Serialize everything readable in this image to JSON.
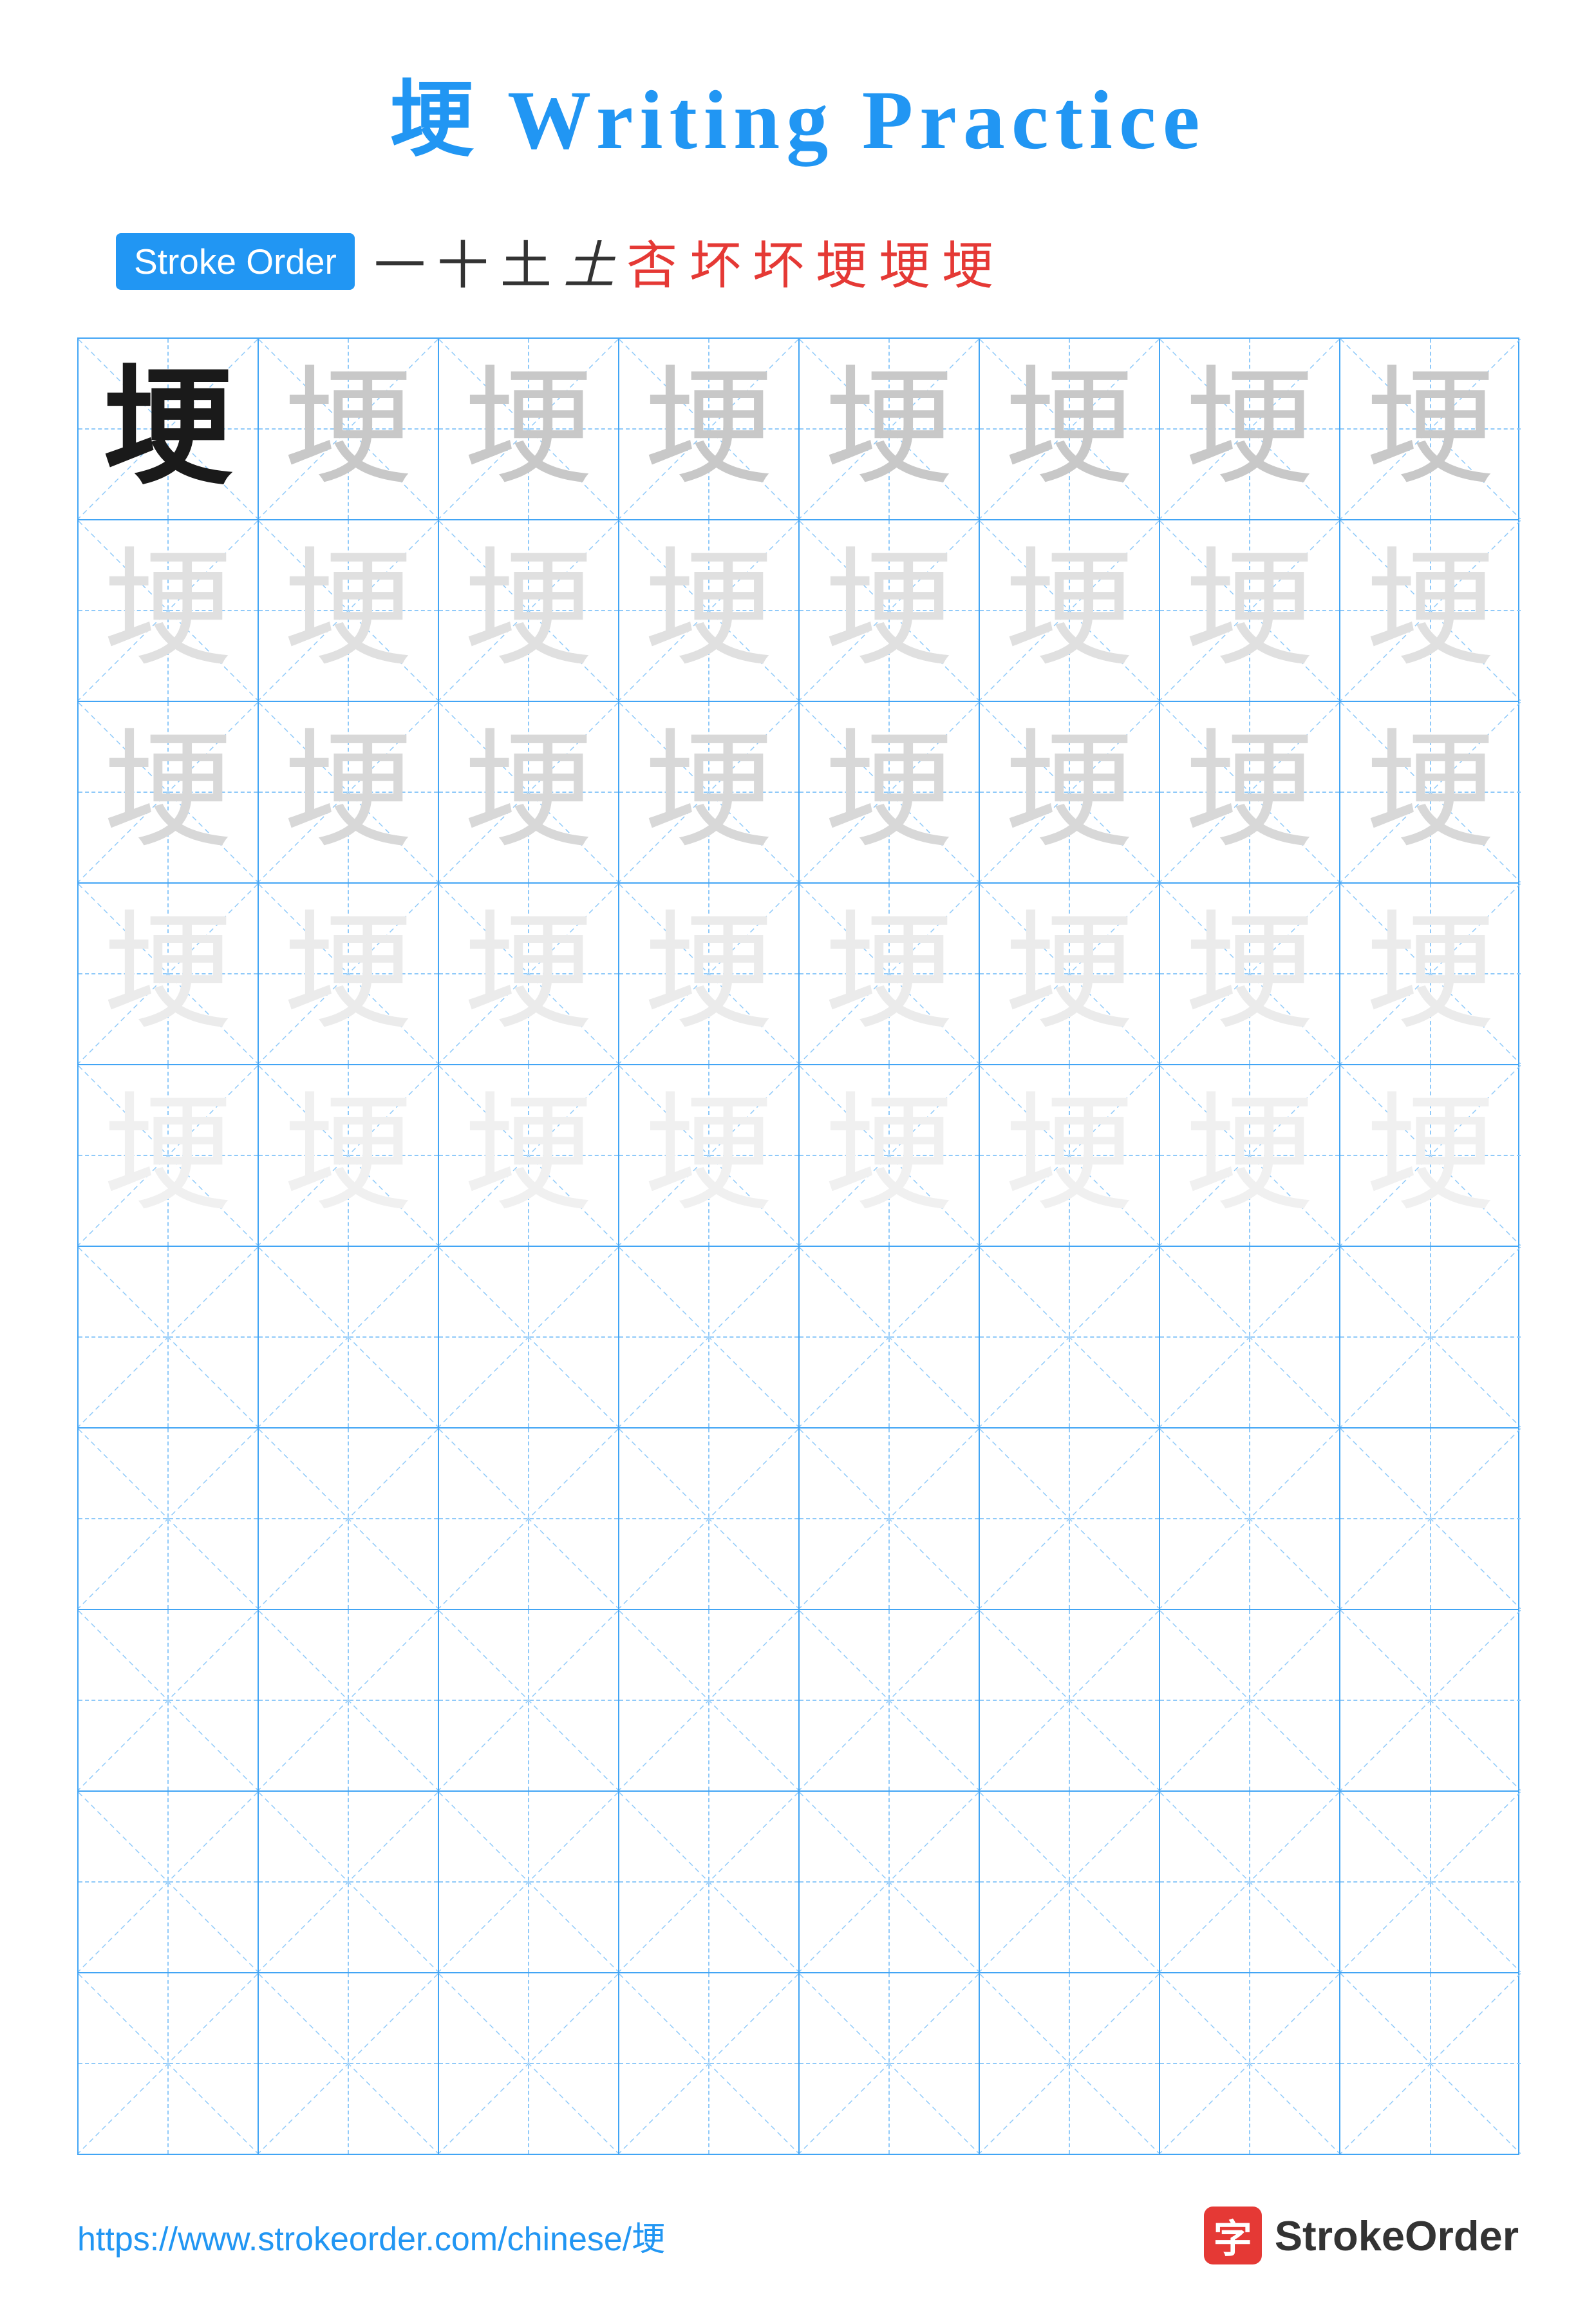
{
  "title": {
    "char": "埂",
    "label": "Writing Practice",
    "full": "埂 Writing Practice"
  },
  "stroke_order": {
    "badge": "Stroke Order",
    "strokes": [
      "一",
      "十",
      "土",
      "土",
      "㕻",
      "坏",
      "坏",
      "埂",
      "埂",
      "埂"
    ]
  },
  "grid": {
    "rows": 10,
    "cols": 8,
    "char": "埂",
    "practice_rows": 5,
    "empty_rows": 5
  },
  "footer": {
    "url": "https://www.strokeorder.com/chinese/埂",
    "brand_char": "字",
    "brand_name": "StrokeOrder"
  }
}
